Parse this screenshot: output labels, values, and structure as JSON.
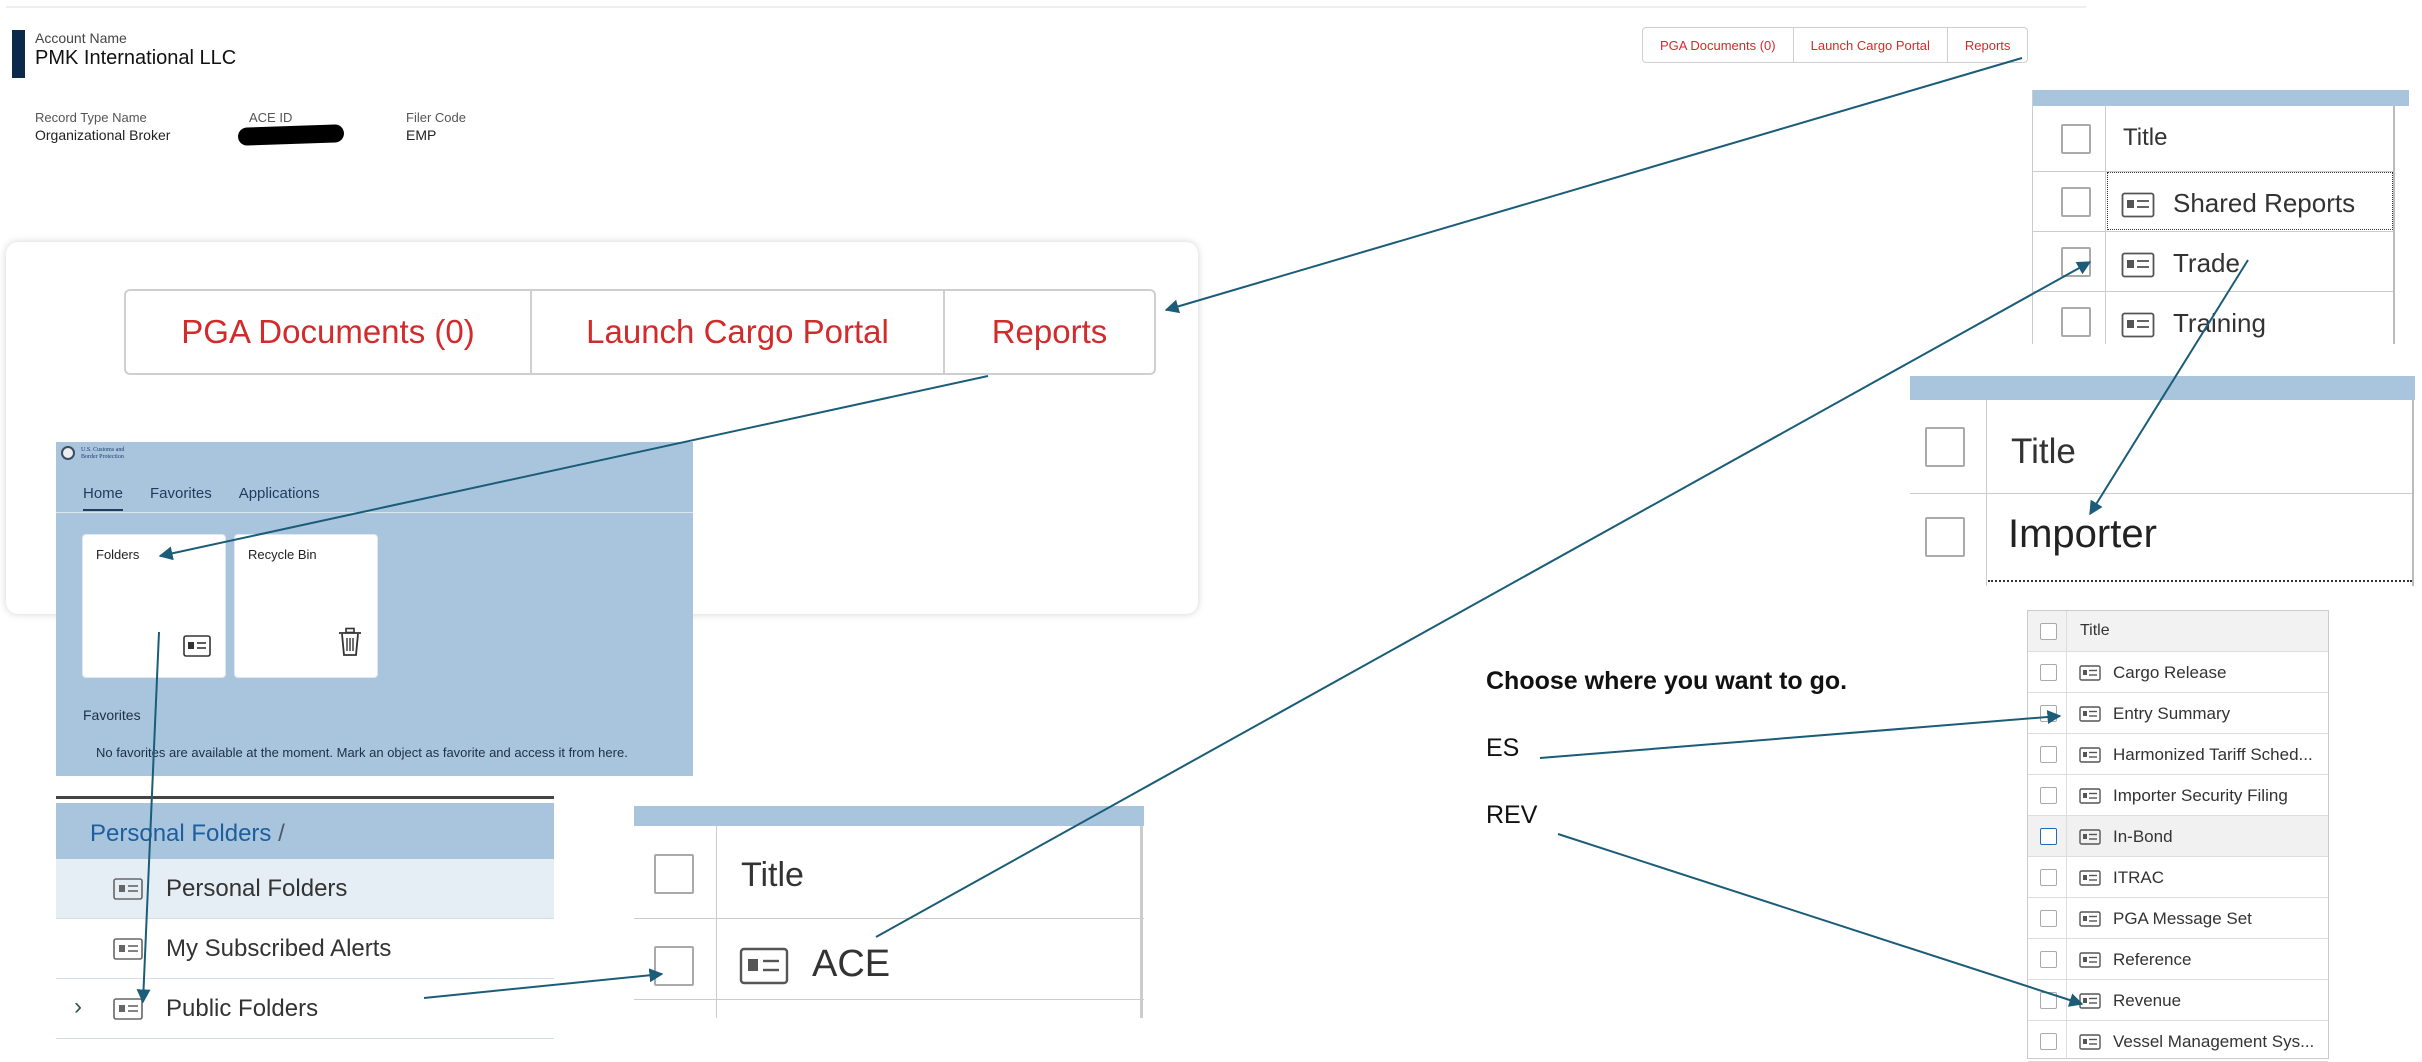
{
  "account": {
    "label": "Account Name",
    "name": "PMK International LLC",
    "fields": [
      {
        "label": "Record Type Name",
        "value": "Organizational Broker"
      },
      {
        "label": "ACE ID",
        "value": ""
      },
      {
        "label": "Filer Code",
        "value": "EMP"
      }
    ]
  },
  "actions": {
    "pga_documents": "PGA Documents (0)",
    "launch_cargo_portal": "Launch Cargo Portal",
    "reports": "Reports"
  },
  "portal": {
    "seal_text_line1": "U.S. Customs and",
    "seal_text_line2": "Border Protection",
    "tabs": [
      "Home",
      "Favorites",
      "Applications"
    ],
    "tiles": {
      "folders": "Folders",
      "recycle_bin": "Recycle Bin"
    },
    "favorites_heading": "Favorites",
    "favorites_message": "No favorites are available at the moment. Mark an object as favorite and access it from here."
  },
  "personal_folders": {
    "breadcrumb": "Personal Folders",
    "breadcrumb_sep": " /",
    "rows": [
      "Personal Folders",
      "My Subscribed Alerts",
      "Public Folders"
    ]
  },
  "ace_table": {
    "header": "Title",
    "row": "ACE"
  },
  "shared_table": {
    "header": "Title",
    "rows": [
      "Shared Reports",
      "Trade",
      "Training"
    ]
  },
  "importer_table": {
    "header": "Title",
    "row": "Importer"
  },
  "navigation": {
    "heading": "Choose where you want to go.",
    "es": "ES",
    "rev": "REV"
  },
  "report_list": {
    "header": "Title",
    "rows": [
      "Cargo Release",
      "Entry Summary",
      "Harmonized Tariff Sched...",
      "Importer Security Filing",
      "In-Bond",
      "ITRAC",
      "PGA Message Set",
      "Reference",
      "Revenue",
      "Vessel Management Sys..."
    ]
  },
  "colors": {
    "accent": "#d22b2b",
    "panel": "#a9c5de",
    "arrow": "#1b5c79",
    "brand_bar": "#0b2a4a"
  }
}
